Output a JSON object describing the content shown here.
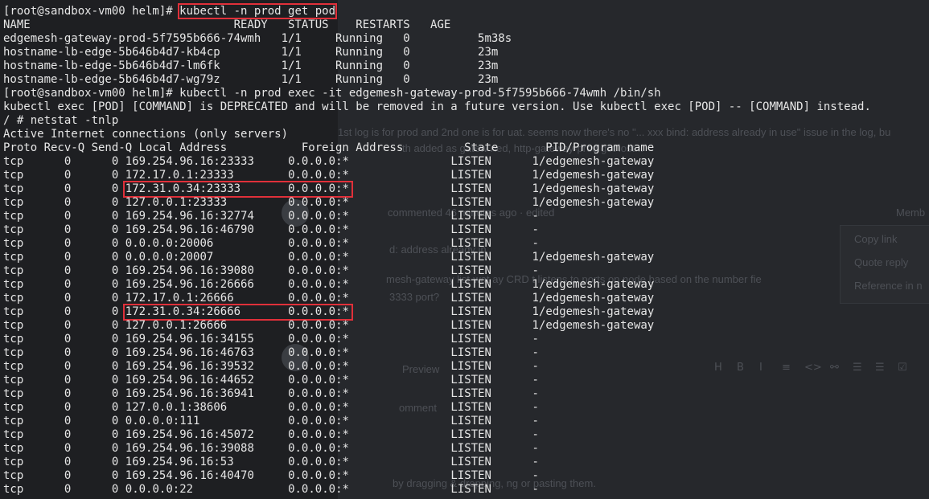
{
  "background_page": {
    "comment_line": "1st log is for prod and 2nd one is for uat. seems now there's no \"... xxx bind: address already in use\" issue in the log, bu",
    "comment_line2": "th added as         gatew                                    ned, http-gateway-prod got lost...",
    "commented_text": "commented 46 minutes ago · edited",
    "member_label": "Memb",
    "menu_items": [
      "Copy link",
      "Quote reply",
      "Reference in n"
    ],
    "bind_text": "d: address already in",
    "gateway_text": "mesh-gateway list-wat         ay CRD      t listens to ports on node based on the  number  fie",
    "port_text": "3333 port?",
    "preview_tab": "Preview",
    "comment_label": "omment",
    "attach_text": "by dragging & dropping,            ng or pasting them.",
    "toolbar_icons": [
      "H",
      "B",
      "I",
      "≡",
      "<>",
      "⚯",
      "☰",
      "☰",
      "☑"
    ]
  },
  "terminal": {
    "lines": [
      {
        "text": "[root@sandbox-vm00 helm]# ",
        "cmd": "kubectl -n prod get pod",
        "highlight": true
      },
      {
        "text": "NAME                              READY   STATUS    RESTARTS   AGE"
      },
      {
        "text": "edgemesh-gateway-prod-5f7595b666-74wmh   1/1     Running   0          5m38s"
      },
      {
        "text": "hostname-lb-edge-5b646b4d7-kb4cp         1/1     Running   0          23m"
      },
      {
        "text": "hostname-lb-edge-5b646b4d7-lm6fk         1/1     Running   0          23m"
      },
      {
        "text": "hostname-lb-edge-5b646b4d7-wg79z         1/1     Running   0          23m"
      },
      {
        "text": "[root@sandbox-vm00 helm]# kubectl -n prod exec -it edgemesh-gateway-prod-5f7595b666-74wmh /bin/sh"
      },
      {
        "text": "kubectl exec [POD] [COMMAND] is DEPRECATED and will be removed in a future version. Use kubectl exec [POD] -- [COMMAND] instead."
      },
      {
        "text": "/ # netstat -tnlp"
      },
      {
        "text": "Active Internet connections (only servers)"
      },
      {
        "text": "Proto Recv-Q Send-Q Local Address           Foreign Address         State       PID/Program name"
      }
    ],
    "netstat_rows": [
      {
        "proto": "tcp",
        "recv": "0",
        "send": "0",
        "local": "169.254.96.16:23333",
        "foreign": "0.0.0.0:*",
        "state": "LISTEN",
        "pid": "1/edgemesh-gateway",
        "highlight": false
      },
      {
        "proto": "tcp",
        "recv": "0",
        "send": "0",
        "local": "172.17.0.1:23333",
        "foreign": "0.0.0.0:*",
        "state": "LISTEN",
        "pid": "1/edgemesh-gateway",
        "highlight": false
      },
      {
        "proto": "tcp",
        "recv": "0",
        "send": "0",
        "local": "172.31.0.34:23333",
        "foreign": "0.0.0.0:*",
        "state": "LISTEN",
        "pid": "1/edgemesh-gateway",
        "highlight": true
      },
      {
        "proto": "tcp",
        "recv": "0",
        "send": "0",
        "local": "127.0.0.1:23333",
        "foreign": "0.0.0.0:*",
        "state": "LISTEN",
        "pid": "1/edgemesh-gateway",
        "highlight": false
      },
      {
        "proto": "tcp",
        "recv": "0",
        "send": "0",
        "local": "169.254.96.16:32774",
        "foreign": "0.0.0.0:*",
        "state": "LISTEN",
        "pid": "-",
        "highlight": false
      },
      {
        "proto": "tcp",
        "recv": "0",
        "send": "0",
        "local": "169.254.96.16:46790",
        "foreign": "0.0.0.0:*",
        "state": "LISTEN",
        "pid": "-",
        "highlight": false
      },
      {
        "proto": "tcp",
        "recv": "0",
        "send": "0",
        "local": "0.0.0.0:20006",
        "foreign": "0.0.0.0:*",
        "state": "LISTEN",
        "pid": "-",
        "highlight": false
      },
      {
        "proto": "tcp",
        "recv": "0",
        "send": "0",
        "local": "0.0.0.0:20007",
        "foreign": "0.0.0.0:*",
        "state": "LISTEN",
        "pid": "1/edgemesh-gateway",
        "highlight": false
      },
      {
        "proto": "tcp",
        "recv": "0",
        "send": "0",
        "local": "169.254.96.16:39080",
        "foreign": "0.0.0.0:*",
        "state": "LISTEN",
        "pid": "-",
        "highlight": false
      },
      {
        "proto": "tcp",
        "recv": "0",
        "send": "0",
        "local": "169.254.96.16:26666",
        "foreign": "0.0.0.0:*",
        "state": "LISTEN",
        "pid": "1/edgemesh-gateway",
        "highlight": false
      },
      {
        "proto": "tcp",
        "recv": "0",
        "send": "0",
        "local": "172.17.0.1:26666",
        "foreign": "0.0.0.0:*",
        "state": "LISTEN",
        "pid": "1/edgemesh-gateway",
        "highlight": false
      },
      {
        "proto": "tcp",
        "recv": "0",
        "send": "0",
        "local": "172.31.0.34:26666",
        "foreign": "0.0.0.0:*",
        "state": "LISTEN",
        "pid": "1/edgemesh-gateway",
        "highlight": true
      },
      {
        "proto": "tcp",
        "recv": "0",
        "send": "0",
        "local": "127.0.0.1:26666",
        "foreign": "0.0.0.0:*",
        "state": "LISTEN",
        "pid": "1/edgemesh-gateway",
        "highlight": false
      },
      {
        "proto": "tcp",
        "recv": "0",
        "send": "0",
        "local": "169.254.96.16:34155",
        "foreign": "0.0.0.0:*",
        "state": "LISTEN",
        "pid": "-",
        "highlight": false
      },
      {
        "proto": "tcp",
        "recv": "0",
        "send": "0",
        "local": "169.254.96.16:46763",
        "foreign": "0.0.0.0:*",
        "state": "LISTEN",
        "pid": "-",
        "highlight": false
      },
      {
        "proto": "tcp",
        "recv": "0",
        "send": "0",
        "local": "169.254.96.16:39532",
        "foreign": "0.0.0.0:*",
        "state": "LISTEN",
        "pid": "-",
        "highlight": false
      },
      {
        "proto": "tcp",
        "recv": "0",
        "send": "0",
        "local": "169.254.96.16:44652",
        "foreign": "0.0.0.0:*",
        "state": "LISTEN",
        "pid": "-",
        "highlight": false
      },
      {
        "proto": "tcp",
        "recv": "0",
        "send": "0",
        "local": "169.254.96.16:36941",
        "foreign": "0.0.0.0:*",
        "state": "LISTEN",
        "pid": "-",
        "highlight": false
      },
      {
        "proto": "tcp",
        "recv": "0",
        "send": "0",
        "local": "127.0.0.1:38606",
        "foreign": "0.0.0.0:*",
        "state": "LISTEN",
        "pid": "-",
        "highlight": false
      },
      {
        "proto": "tcp",
        "recv": "0",
        "send": "0",
        "local": "0.0.0.0:111",
        "foreign": "0.0.0.0:*",
        "state": "LISTEN",
        "pid": "-",
        "highlight": false
      },
      {
        "proto": "tcp",
        "recv": "0",
        "send": "0",
        "local": "169.254.96.16:45072",
        "foreign": "0.0.0.0:*",
        "state": "LISTEN",
        "pid": "-",
        "highlight": false
      },
      {
        "proto": "tcp",
        "recv": "0",
        "send": "0",
        "local": "169.254.96.16:39088",
        "foreign": "0.0.0.0:*",
        "state": "LISTEN",
        "pid": "-",
        "highlight": false
      },
      {
        "proto": "tcp",
        "recv": "0",
        "send": "0",
        "local": "169.254.96.16:53",
        "foreign": "0.0.0.0:*",
        "state": "LISTEN",
        "pid": "-",
        "highlight": false
      },
      {
        "proto": "tcp",
        "recv": "0",
        "send": "0",
        "local": "169.254.96.16:40470",
        "foreign": "0.0.0.0:*",
        "state": "LISTEN",
        "pid": "-",
        "highlight": false
      },
      {
        "proto": "tcp",
        "recv": "0",
        "send": "0",
        "local": "0.0.0.0:22",
        "foreign": "0.0.0.0:*",
        "state": "LISTEN",
        "pid": "-",
        "highlight": false
      }
    ]
  },
  "colors": {
    "terminal_text": "#e6e6e6",
    "highlight_box": "#e0303a",
    "background": "#1e1f22"
  }
}
